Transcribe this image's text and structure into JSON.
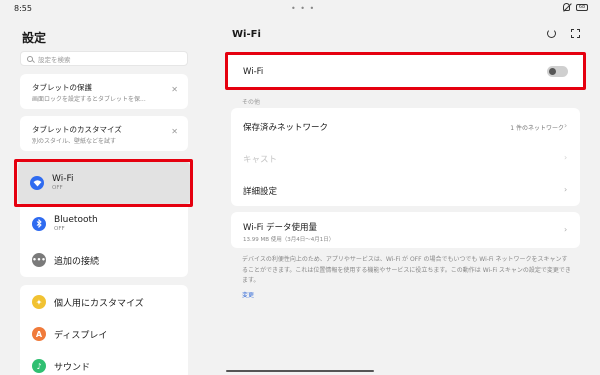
{
  "status_bar": {
    "time": "8:55",
    "dots": "• • •",
    "battery": "68"
  },
  "left": {
    "title": "設定",
    "search_placeholder": "設定を検索",
    "tips": [
      {
        "title": "タブレットの保護",
        "subtitle": "画面ロックを設定するとタブレットを保..."
      },
      {
        "title": "タブレットのカスタマイズ",
        "subtitle": "別のスタイル、壁紙などを試す"
      }
    ],
    "connection_items": [
      {
        "label": "Wi-Fi",
        "sub": "OFF",
        "icon": "wifi-icon",
        "color": "#2f6bf0"
      },
      {
        "label": "Bluetooth",
        "sub": "OFF",
        "icon": "bluetooth-icon",
        "color": "#2f6bf0"
      },
      {
        "label": "追加の接続",
        "sub": "",
        "icon": "more-connections-icon",
        "color": "#7a7a7a"
      }
    ],
    "other_items": [
      {
        "label": "個人用にカスタマイズ",
        "icon": "personalize-icon",
        "color": "#f1c232"
      },
      {
        "label": "ディスプレイ",
        "icon": "display-icon",
        "color": "#f07a3a"
      },
      {
        "label": "サウンド",
        "icon": "sound-icon",
        "color": "#2fbf71"
      }
    ]
  },
  "right": {
    "title": "Wi-Fi",
    "wifi_toggle_label": "Wi-Fi",
    "wifi_state": "off",
    "section_label": "その他",
    "rows": [
      {
        "label": "保存済みネットワーク",
        "value": "1 件のネットワーク",
        "disabled": false
      },
      {
        "label": "キャスト",
        "value": "",
        "disabled": true
      },
      {
        "label": "詳細設定",
        "value": "",
        "disabled": false
      }
    ],
    "usage": {
      "label": "Wi-Fi データ使用量",
      "sub": "13.99 MB 使用（3月4日～4月1日）"
    },
    "description": "デバイスの利便性向上のため、アプリやサービスは、Wi-Fi が OFF の場合でもいつでも Wi-Fi ネットワークをスキャンすることができます。これは位置情報を使用する機能やサービスに役立ちます。この動作は Wi-Fi スキャンの設定で変更できます。",
    "change_link": "変更"
  },
  "colors": {
    "highlight": "#e5000f",
    "accent_blue": "#2f6bf0",
    "link_blue": "#3a6fd8"
  }
}
